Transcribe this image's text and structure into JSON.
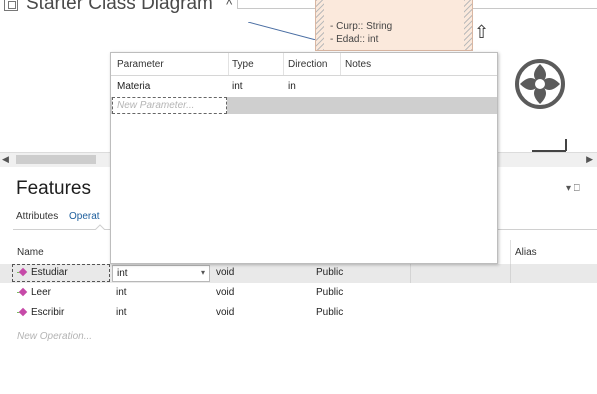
{
  "diagram": {
    "title": "Starter Class Diagram",
    "title_caret": "^",
    "class_attributes": [
      "-   Curp:: String",
      "-   Edad:: int"
    ]
  },
  "features": {
    "title": "Features",
    "panel_controls": "▾  ⎕",
    "tabs": [
      "Attributes",
      "Operat"
    ]
  },
  "operations": {
    "columns": [
      "Name",
      "Alias"
    ],
    "rows": [
      {
        "name": "Estudiar",
        "type": "int",
        "return": "void",
        "scope": "Public"
      },
      {
        "name": "Leer",
        "type": "int",
        "return": "void",
        "scope": "Public"
      },
      {
        "name": "Escribir",
        "type": "int",
        "return": "void",
        "scope": "Public"
      }
    ],
    "new_placeholder": "New Operation..."
  },
  "parameters": {
    "columns": [
      "Parameter",
      "Type",
      "Direction",
      "Notes"
    ],
    "rows": [
      {
        "name": "Materia",
        "type": "int",
        "direction": "in",
        "notes": ""
      }
    ],
    "new_placeholder": "New Parameter..."
  },
  "colors": {
    "class_fill": "#fbe9dc",
    "selected_row": "#e9e9e9",
    "tab_accent": "#1d5e9c"
  }
}
